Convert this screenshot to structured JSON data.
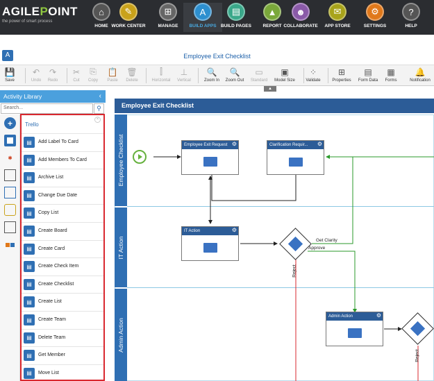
{
  "nav": {
    "logo": "AGILEPOINT",
    "tagline": "the power of smart process",
    "items": [
      {
        "label": "HOME",
        "icon": "home-icon",
        "glyph": "⌂",
        "color": "#555"
      },
      {
        "label": "WORK CENTER",
        "icon": "work-center-icon",
        "glyph": "✎",
        "color": "#c9a21a"
      },
      {
        "label": "MANAGE",
        "icon": "manage-icon",
        "glyph": "⊞",
        "color": "#666"
      },
      {
        "label": "BUILD APPS",
        "icon": "build-apps-icon",
        "glyph": "A",
        "color": "#2d8fcf"
      },
      {
        "label": "BUILD PAGES",
        "icon": "build-pages-icon",
        "glyph": "▤",
        "color": "#3aa88a"
      },
      {
        "label": "REPORT",
        "icon": "report-icon",
        "glyph": "▲",
        "color": "#7aa83a"
      },
      {
        "label": "COLLABORATE",
        "icon": "collaborate-icon",
        "glyph": "☻",
        "color": "#8a5aa8"
      },
      {
        "label": "APP STORE",
        "icon": "app-store-icon",
        "glyph": "✉",
        "color": "#a8a31a"
      },
      {
        "label": "SETTINGS",
        "icon": "settings-icon",
        "glyph": "⚙",
        "color": "#e0781a"
      },
      {
        "label": "HELP",
        "icon": "help-icon",
        "glyph": "?",
        "color": "#555"
      }
    ]
  },
  "title": "Employee Exit Checklist",
  "toolbar": [
    {
      "label": "Save",
      "glyph": "💾",
      "disabled": false
    },
    {
      "label": "Undo",
      "glyph": "↶",
      "disabled": true
    },
    {
      "label": "Redo",
      "glyph": "↷",
      "disabled": true
    },
    {
      "label": "Cut",
      "glyph": "✂",
      "disabled": true
    },
    {
      "label": "Copy",
      "glyph": "⎘",
      "disabled": true
    },
    {
      "label": "Paste",
      "glyph": "📋",
      "disabled": true
    },
    {
      "label": "Delete",
      "glyph": "🗑",
      "disabled": true
    },
    {
      "label": "Horizontal",
      "glyph": "⫿",
      "disabled": true
    },
    {
      "label": "Vertical",
      "glyph": "⊥",
      "disabled": true
    },
    {
      "label": "Zoom In",
      "glyph": "🔍",
      "disabled": false
    },
    {
      "label": "Zoom Out",
      "glyph": "🔍",
      "disabled": false
    },
    {
      "label": "Standard",
      "glyph": "▭",
      "disabled": true
    },
    {
      "label": "Model Size",
      "glyph": "▣",
      "disabled": false
    },
    {
      "label": "Validate",
      "glyph": "⁘",
      "disabled": false
    },
    {
      "label": "Properties",
      "glyph": "⊞",
      "disabled": false
    },
    {
      "label": "Form Data",
      "glyph": "▤",
      "disabled": false
    },
    {
      "label": "Forms",
      "glyph": "▦",
      "disabled": false
    },
    {
      "label": "Notification",
      "glyph": "🔔",
      "disabled": false
    }
  ],
  "library": {
    "title": "Activity Library",
    "search_placeholder": "Search...",
    "category": "Trello",
    "items": [
      "Add Label To Card",
      "Add Members To Card",
      "Archive List",
      "Change Due Date",
      "Copy List",
      "Create Board",
      "Create Card",
      "Create Check Item",
      "Create Checklist",
      "Create List",
      "Create Team",
      "Delete Team",
      "Get Member",
      "Move List"
    ]
  },
  "process": {
    "pool": "Employee Exit Checklist",
    "lanes": [
      "Employee Checklist",
      "IT Action",
      "Admin Action"
    ],
    "tasks": [
      "Employee Exit Request",
      "Clarification Requir...",
      "IT Action",
      "Admin Action"
    ],
    "labels": {
      "get_clarity": "Get Clarity",
      "approve": "Approve",
      "reject": "Reject"
    }
  }
}
